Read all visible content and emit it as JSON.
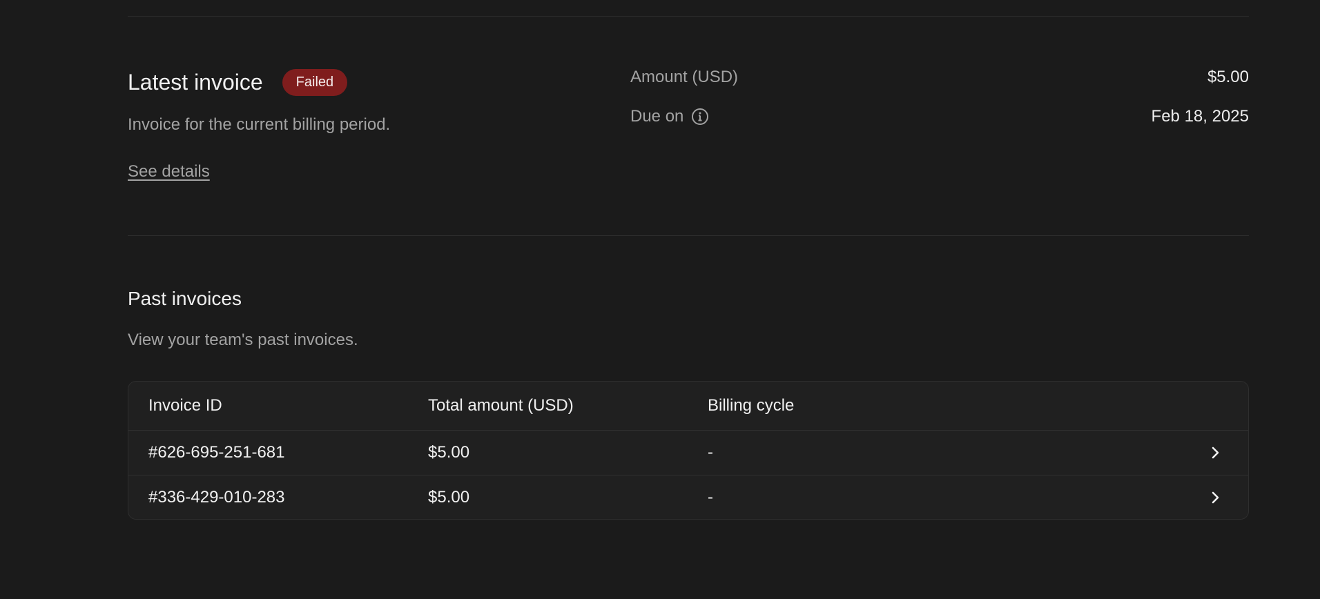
{
  "latest_invoice": {
    "title": "Latest invoice",
    "status": "Failed",
    "status_color": "#7f1d1d",
    "description": "Invoice for the current billing period.",
    "details_link": "See details",
    "amount_label": "Amount (USD)",
    "amount_value": "$5.00",
    "due_label": "Due on",
    "due_icon": "info-icon",
    "due_value": "Feb 18, 2025"
  },
  "past_invoices": {
    "title": "Past invoices",
    "description": "View your team's past invoices.",
    "columns": [
      "Invoice ID",
      "Total amount (USD)",
      "Billing cycle"
    ],
    "rows": [
      {
        "id": "#626-695-251-681",
        "amount": "$5.00",
        "cycle": "-",
        "action_icon": "chevron-right-icon"
      },
      {
        "id": "#336-429-010-283",
        "amount": "$5.00",
        "cycle": "-",
        "action_icon": "chevron-right-icon"
      }
    ]
  },
  "colors": {
    "background": "#1b1b1b",
    "table_background": "#202020",
    "muted_text": "#a3a3a3"
  }
}
